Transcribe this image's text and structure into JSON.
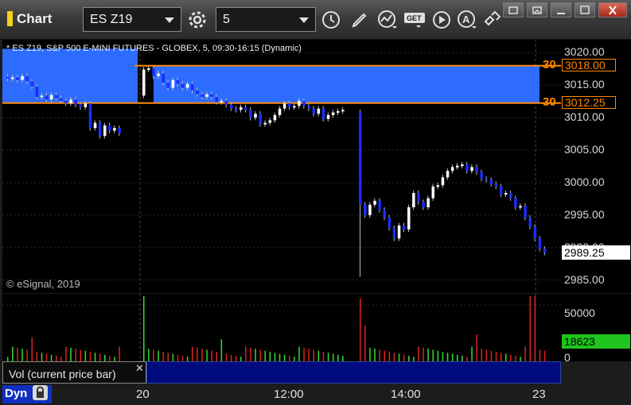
{
  "window": {
    "title": "Chart"
  },
  "toolbar": {
    "symbol": "ES Z19",
    "interval": "5",
    "icons": [
      "settings-gear-icon",
      "clock-icon",
      "pencil-icon",
      "study-icon",
      "get-icon",
      "play-icon",
      "alert-icon",
      "link-icon"
    ]
  },
  "chart": {
    "caption": "* ES Z19, S&P 500 E-MINI FUTURES - GLOBEX, 5, 09:30-16:15 (Dynamic)",
    "copyright": "© eSignal, 2019",
    "price_axis": [
      "3020.00",
      "3015.00",
      "3010.00",
      "3005.00",
      "3000.00",
      "2995.00",
      "2990.00",
      "2985.00"
    ],
    "levels": [
      {
        "count": "30",
        "price": "3018.00"
      },
      {
        "count": "30",
        "price": "3012.25"
      }
    ],
    "last_price": "2989.25",
    "colors": {
      "band": "#2d6cff",
      "level": "#ff8800",
      "down": "#1a2cff",
      "up": "#ffffff"
    }
  },
  "chart_data": {
    "type": "candlestick",
    "title": "* ES Z19, S&P 500 E-MINI FUTURES - GLOBEX, 5, 09:30-16:15 (Dynamic)",
    "ylim": [
      2983,
      3022
    ],
    "grid": true,
    "x_ticks": [
      "20",
      "12:00",
      "14:00",
      "23"
    ],
    "closes": [
      3016,
      3016.2,
      3015.8,
      3016.4,
      3015.6,
      3014.8,
      3013.2,
      3013.4,
      3012.8,
      3013.5,
      3013,
      3012.6,
      3012.2,
      3012.8,
      3012,
      3011.6,
      3012.2,
      3008.4,
      3009.2,
      3007.2,
      3008.8,
      3008,
      3008.4,
      3007.6,
      3017.4,
      3017.6,
      3016.4,
      3016.8,
      3015.4,
      3014.6,
      3015.8,
      3015.2,
      3014.6,
      3015.2,
      3014.2,
      3013.6,
      3013.2,
      3013.6,
      3013.2,
      3012.4,
      3012.6,
      3012,
      3011.4,
      3011.2,
      3011.6,
      3011.2,
      3010,
      3010.6,
      3009,
      3009.2,
      3009.6,
      3010.4,
      3011.4,
      3012.2,
      3011.6,
      3011.8,
      3012.6,
      3011.8,
      3011.4,
      3010.6,
      3011.4,
      3009.8,
      3010.4,
      3010.8,
      3011,
      3011.2,
      2996.6,
      2995,
      2996.6,
      2997.2,
      2995.8,
      2994.6,
      2993,
      2991.4,
      2993.4,
      2992.8,
      2996.2,
      2998.4,
      2997,
      2996.2,
      2997.6,
      2999.4,
      2999.6,
      3000.8,
      3001.8,
      3002.4,
      3002.6,
      3002.8,
      3001.8,
      3002.4,
      3001.6,
      3000.6,
      3000.4,
      2999.8,
      2999.4,
      2998.2,
      2998.4,
      2997.6,
      2996.2,
      2996.4,
      2994.6,
      2993.2,
      2991.4,
      2989.8,
      2989.2
    ],
    "volume_ticks": [
      "50000",
      "0"
    ],
    "volume_last": "18623",
    "volume_ylim": [
      0,
      60000
    ]
  },
  "study": {
    "label": "Vol (current price bar)"
  },
  "bottom": {
    "dyn_label": "Dyn",
    "time_labels": [
      "20",
      "12:00",
      "14:00",
      "23"
    ]
  }
}
